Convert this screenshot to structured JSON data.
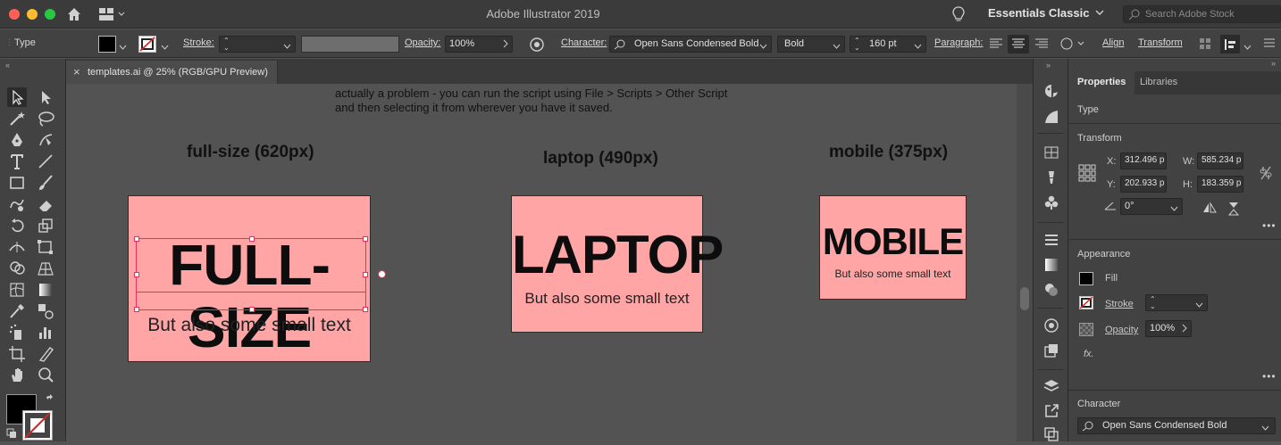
{
  "window": {
    "title": "Adobe Illustrator 2019"
  },
  "titlebar": {
    "workspace": "Essentials Classic",
    "search_placeholder": "Search Adobe Stock"
  },
  "control_bar": {
    "mode": "Type",
    "stroke_label": "Stroke:",
    "opacity_label": "Opacity:",
    "opacity_value": "100%",
    "character_label": "Character:",
    "font_family": "Open Sans Condensed Bold",
    "font_style": "Bold",
    "font_size": "160 pt",
    "paragraph_label": "Paragraph:",
    "align": "Align",
    "transform": "Transform"
  },
  "document_tab": {
    "title": "templates.ai @ 25% (RGB/GPU Preview)",
    "close": "×"
  },
  "canvas": {
    "note_lines": [
      "actually a problem - you can run the script using File > Scripts > Other Script",
      "and then selecting it from wherever you have it saved."
    ],
    "artboards": [
      {
        "label": "full-size (620px)",
        "headline": "FULL-SIZE",
        "subtext": "But also some small text"
      },
      {
        "label": "laptop (490px)",
        "headline": "LAPTOP",
        "subtext": "But also some small text"
      },
      {
        "label": "mobile (375px)",
        "headline": "MOBILE",
        "subtext": "But also some small text"
      }
    ],
    "artboard_color": "#ffa5a6",
    "selection_color": "#e8305a"
  },
  "properties_panel": {
    "tabs": [
      "Properties",
      "Libraries"
    ],
    "selection_type": "Type",
    "transform": {
      "title": "Transform",
      "x_label": "X:",
      "x": "312.496 p",
      "y_label": "Y:",
      "y": "202.933 p",
      "w_label": "W:",
      "w": "585.234 p",
      "h_label": "H:",
      "h": "183.359 p",
      "rotation": "0°"
    },
    "appearance": {
      "title": "Appearance",
      "fill": "Fill",
      "stroke": "Stroke",
      "opacity_label": "Opacity",
      "opacity_value": "100%",
      "fx": "fx."
    },
    "character": {
      "title": "Character",
      "font_family": "Open Sans Condensed Bold"
    }
  },
  "colors": {
    "fill": "#000000",
    "traffic_red": "#fe5f57",
    "traffic_yellow": "#febc2e",
    "traffic_green": "#28c840"
  }
}
